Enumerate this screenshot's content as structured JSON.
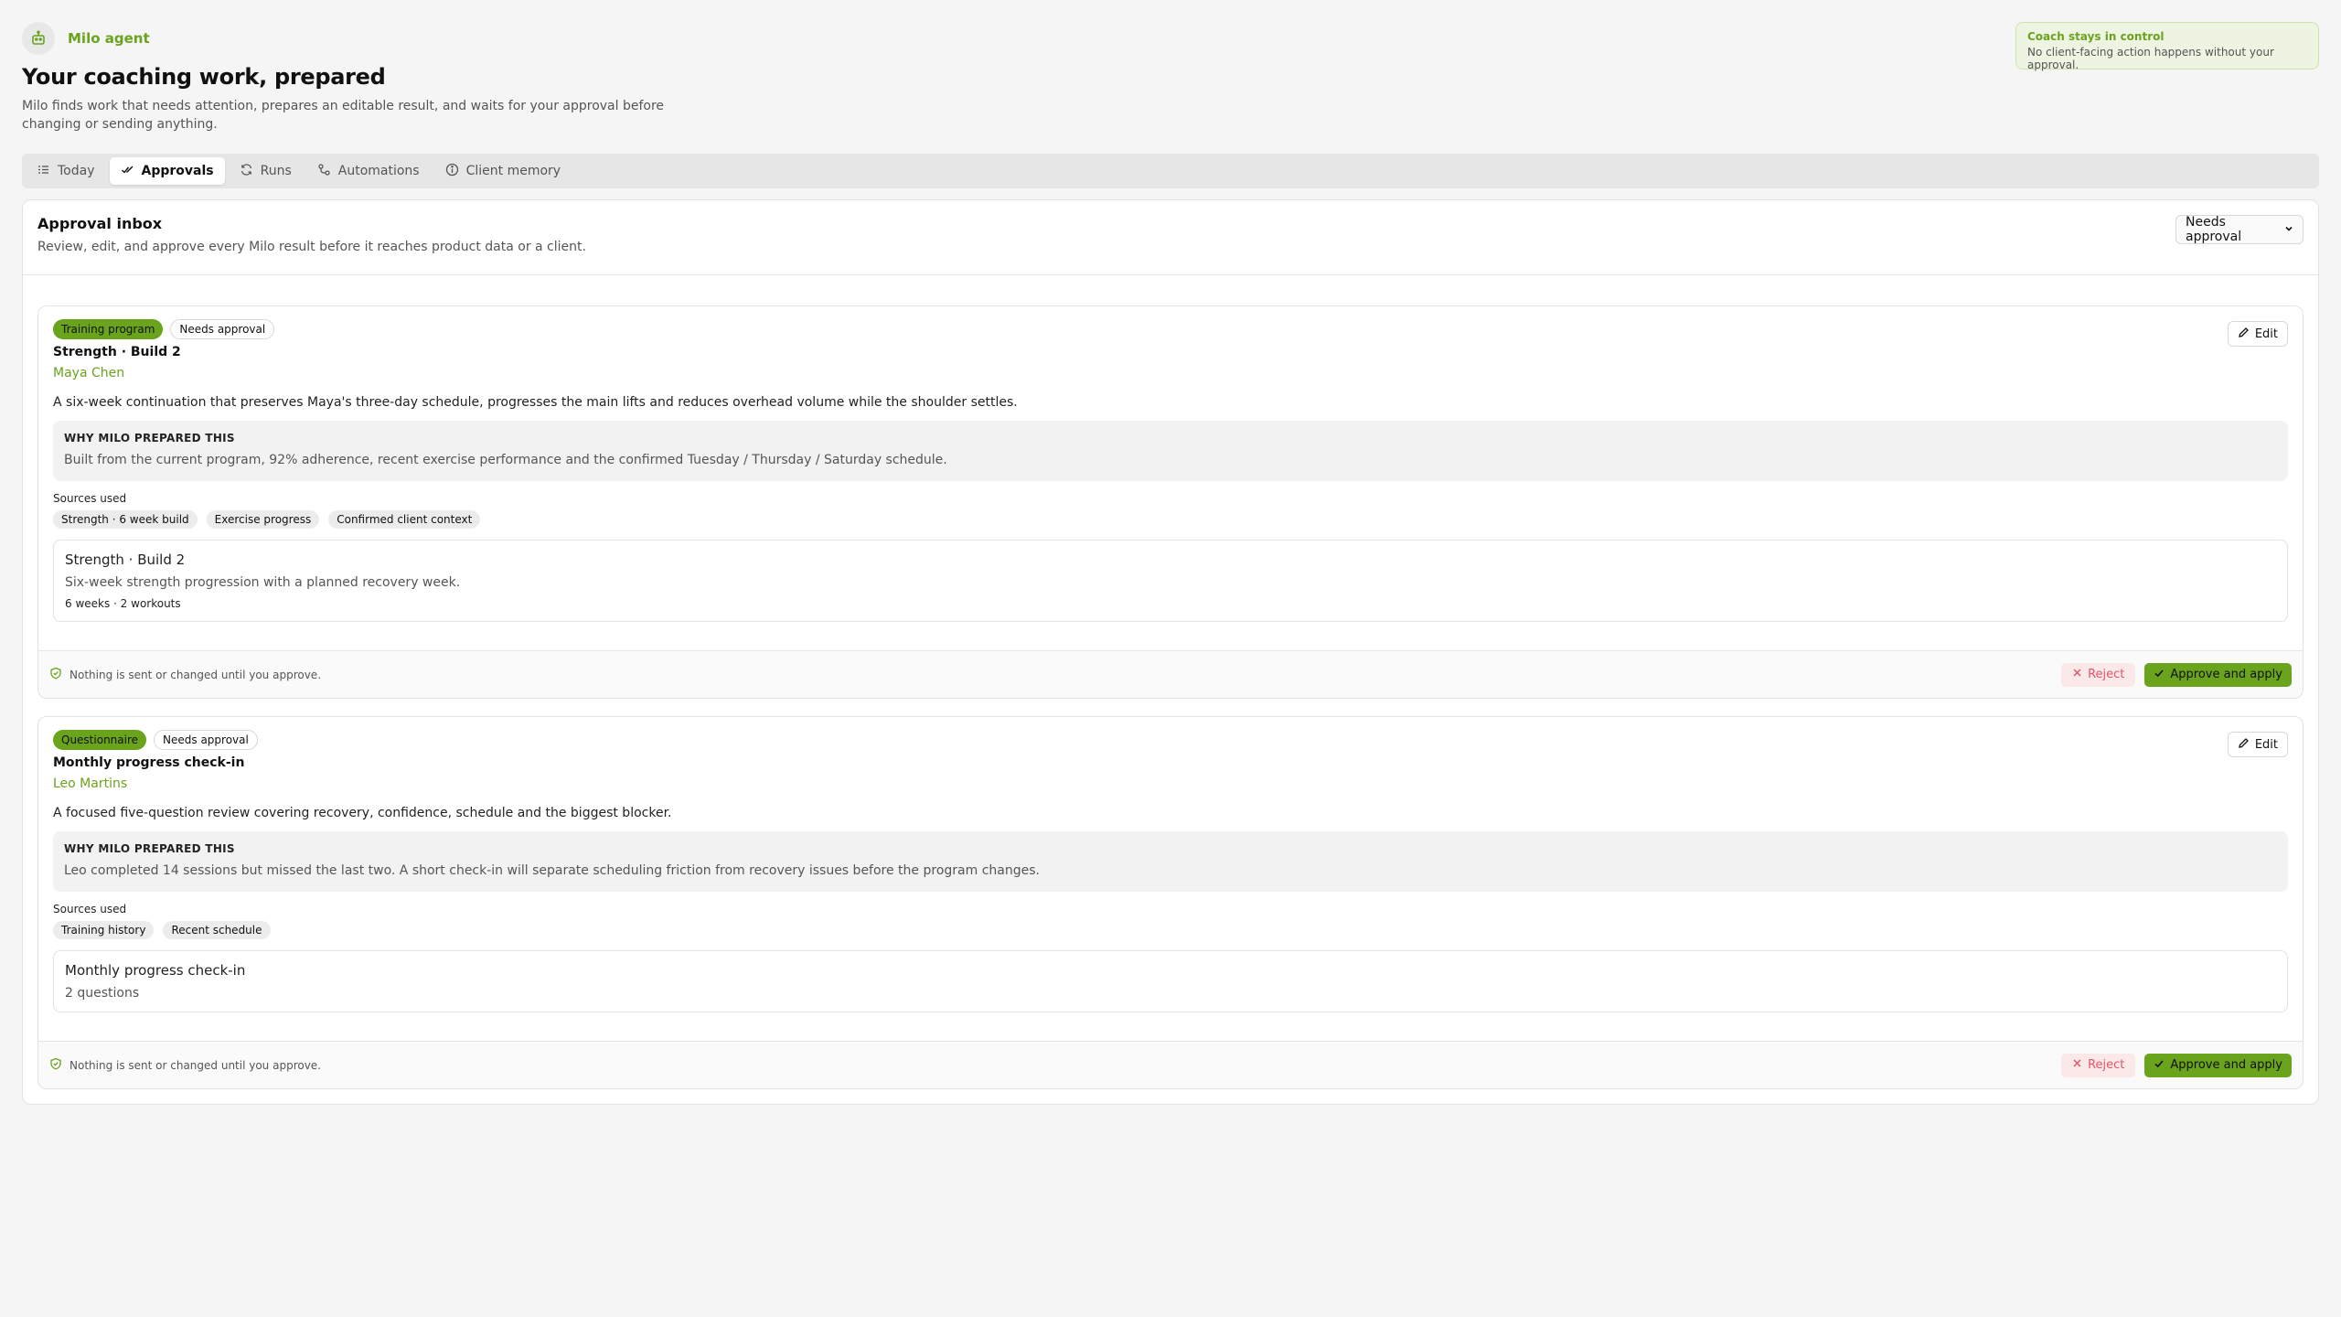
{
  "header": {
    "brand_name": "Milo agent",
    "brand_icon": "robot-icon",
    "title": "Your coaching work, prepared",
    "description": "Milo finds work that needs attention, prepares an editable result, and waits for your approval before changing or sending anything.",
    "accent_color": "#6aa31c"
  },
  "control_note": {
    "title": "Coach stays in control",
    "text": "No client-facing action happens without your approval."
  },
  "tabs": [
    {
      "label": "Today",
      "icon": "list-icon",
      "active": false
    },
    {
      "label": "Approvals",
      "icon": "check-double-icon",
      "active": true
    },
    {
      "label": "Runs",
      "icon": "refresh-icon",
      "active": false
    },
    {
      "label": "Automations",
      "icon": "workflow-icon",
      "active": false
    },
    {
      "label": "Client memory",
      "icon": "info-icon",
      "active": false
    }
  ],
  "inbox": {
    "title": "Approval inbox",
    "description": "Review, edit, and approve every Milo result before it reaches product data or a client.",
    "filter_value": "Needs approval"
  },
  "cards": [
    {
      "type_badge": "Training program",
      "status_badge": "Needs approval",
      "title": "Strength · Build 2",
      "client": "Maya Chen",
      "summary": "A six-week continuation that preserves Maya's three-day schedule, progresses the main lifts and reduces overhead volume while the shoulder settles.",
      "why_label": "WHY MILO PREPARED THIS",
      "why_text": "Built from the current program, 92% adherence, recent exercise performance and the confirmed Tuesday / Thursday / Saturday schedule.",
      "sources_label": "Sources used",
      "sources": [
        "Strength · 6 week build",
        "Exercise progress",
        "Confirmed client context"
      ],
      "preview_title": "Strength · Build 2",
      "preview_sub": "Six-week strength progression with a planned recovery week.",
      "preview_meta": "6 weeks · 2 workouts",
      "edit_label": "Edit",
      "foot_note": "Nothing is sent or changed until you approve.",
      "reject_label": "Reject",
      "approve_label": "Approve and apply"
    },
    {
      "type_badge": "Questionnaire",
      "status_badge": "Needs approval",
      "title": "Monthly progress check-in",
      "client": "Leo Martins",
      "summary": "A focused five-question review covering recovery, confidence, schedule and the biggest blocker.",
      "why_label": "WHY MILO PREPARED THIS",
      "why_text": "Leo completed 14 sessions but missed the last two. A short check-in will separate scheduling friction from recovery issues before the program changes.",
      "sources_label": "Sources used",
      "sources": [
        "Training history",
        "Recent schedule"
      ],
      "preview_title": "Monthly progress check-in",
      "preview_sub": "2 questions",
      "edit_label": "Edit",
      "foot_note": "Nothing is sent or changed until you approve.",
      "reject_label": "Reject",
      "approve_label": "Approve and apply"
    }
  ]
}
